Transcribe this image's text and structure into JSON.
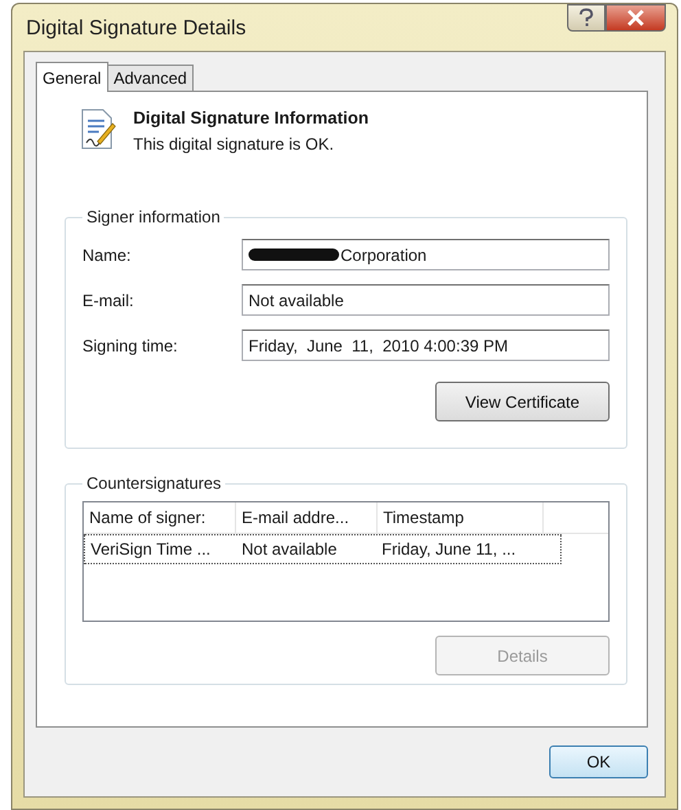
{
  "window": {
    "title": "Digital Signature Details"
  },
  "tabs": [
    {
      "label": "General",
      "selected": true
    },
    {
      "label": "Advanced",
      "selected": false
    }
  ],
  "header": {
    "title": "Digital Signature Information",
    "message": "This digital signature is OK."
  },
  "signer": {
    "title": "Signer information",
    "fields": [
      {
        "label": "Name:",
        "value": "Corporation",
        "redacted": true
      },
      {
        "label": "E-mail:",
        "value": "Not available",
        "redacted": false
      },
      {
        "label": "Signing time:",
        "value": "Friday,  June  11,  2010 4:00:39 PM",
        "redacted": false
      }
    ],
    "button": {
      "label": "View Certificate",
      "disabled": false
    }
  },
  "countersignatures": {
    "title": "Countersignatures",
    "columns": [
      "Name of signer:",
      "E-mail addre...",
      "Timestamp"
    ],
    "rows": [
      {
        "cells": [
          "VeriSign Time ...",
          "Not available",
          "Friday, June 11, ..."
        ],
        "selected": true
      }
    ],
    "button": {
      "label": "Details",
      "disabled": true
    }
  },
  "buttons": [
    "OK"
  ]
}
